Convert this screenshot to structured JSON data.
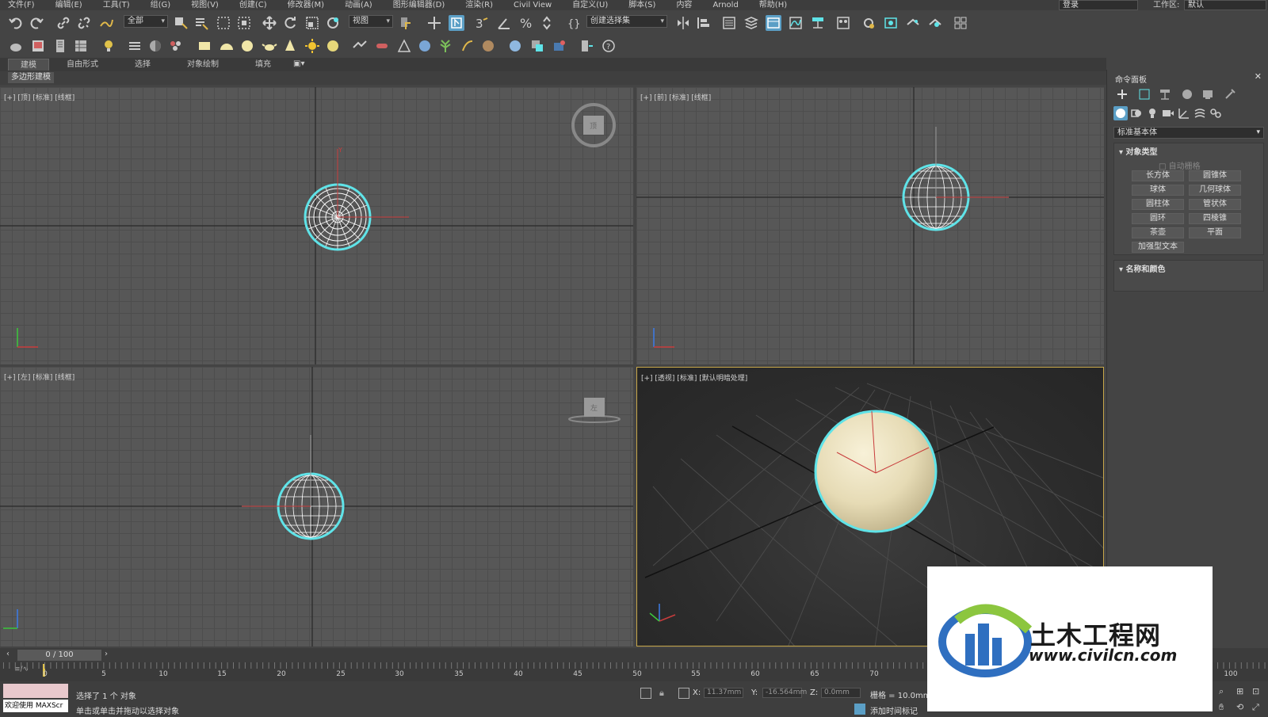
{
  "menubar": {
    "items": [
      "文件(F)",
      "编辑(E)",
      "工具(T)",
      "组(G)",
      "视图(V)",
      "创建(C)",
      "修改器(M)",
      "动画(A)",
      "图形编辑器(D)",
      "渲染(R)",
      "Civil View",
      "自定义(U)",
      "脚本(S)",
      "内容",
      "Arnold",
      "帮助(H)"
    ],
    "login": "登录",
    "workspace_label": "工作区:",
    "workspace_value": "默认"
  },
  "toolbar": {
    "filter_dropdown": "全部",
    "refcoord_dropdown": "视图",
    "selection_set_dropdown": "创建选择集"
  },
  "ribbon": {
    "tabs": [
      "建模",
      "自由形式",
      "选择",
      "对象绘制",
      "填充"
    ],
    "sub_label": "多边形建模"
  },
  "viewports": {
    "top": "[+] [顶] [标准] [线框]",
    "front": "[+] [前] [标准] [线框]",
    "left": "[+] [左] [标准] [线框]",
    "perspective": "[+] [透视] [标准] [默认明暗处理]"
  },
  "command_panel": {
    "title": "命令面板",
    "category": "标准基本体",
    "rollout_object_type": "对象类型",
    "autogrid": "自动栅格",
    "buttons": [
      "长方体",
      "圆锥体",
      "球体",
      "几何球体",
      "圆柱体",
      "管状体",
      "圆环",
      "四棱锥",
      "茶壶",
      "平面",
      "加强型文本"
    ],
    "rollout_name_color": "名称和颜色"
  },
  "timeline": {
    "frame_display": "0 / 100",
    "ticks": [
      "0",
      "5",
      "10",
      "15",
      "20",
      "25",
      "30",
      "35",
      "40",
      "45",
      "50",
      "55",
      "60",
      "65",
      "70",
      "100"
    ]
  },
  "status": {
    "selected": "选择了 1 个 对象",
    "prompt": "单击或单击并拖动以选择对象",
    "maxscript": "欢迎使用 MAXScr",
    "x_label": "X:",
    "x_value": "11.37mm",
    "y_label": "Y:",
    "y_value": "-16.564mm",
    "z_label": "Z:",
    "z_value": "0.0mm",
    "grid": "栅格 = 10.0mm",
    "add_time_tag": "添加时间标记"
  },
  "watermark": {
    "title": "土木工程网",
    "url": "www.civilcn.com"
  },
  "colors": {
    "selection_cyan": "#5fe3e8",
    "active_viewport_border": "#c8a84a",
    "sphere_shaded": "#ede3c2",
    "accent_blue": "#5b9fc6"
  }
}
